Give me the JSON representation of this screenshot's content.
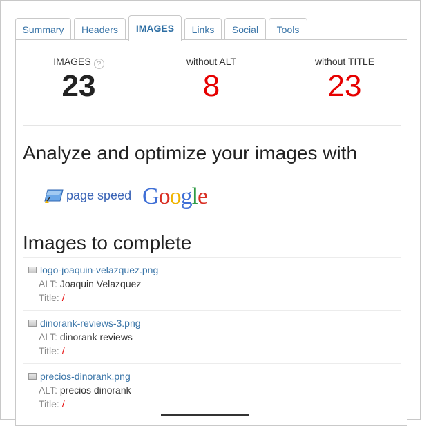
{
  "tabs": [
    {
      "label": "Summary"
    },
    {
      "label": "Headers"
    },
    {
      "label": "IMAGES"
    },
    {
      "label": "Links"
    },
    {
      "label": "Social"
    },
    {
      "label": "Tools"
    }
  ],
  "stats": {
    "images": {
      "label": "IMAGES",
      "value": "23",
      "help": "?"
    },
    "without_alt": {
      "label": "without ALT",
      "value": "8"
    },
    "without_title": {
      "label": "without TITLE",
      "value": "23"
    }
  },
  "analyze": {
    "heading": "Analyze and optimize your images with",
    "page_speed": "page speed",
    "google": [
      "G",
      "o",
      "o",
      "g",
      "l",
      "e"
    ]
  },
  "images_section": {
    "heading": "Images to complete",
    "alt_key": "ALT:",
    "title_key": "Title:",
    "items": [
      {
        "file": "logo-joaquin-velazquez.png",
        "alt": "Joaquin Velazquez",
        "title": "/"
      },
      {
        "file": "dinorank-reviews-3.png",
        "alt": "dinorank reviews",
        "title": "/"
      },
      {
        "file": "precios-dinorank.png",
        "alt": "precios dinorank",
        "title": "/"
      }
    ]
  },
  "colors": {
    "accent": "#3a75a8",
    "alert": "#e60000"
  }
}
